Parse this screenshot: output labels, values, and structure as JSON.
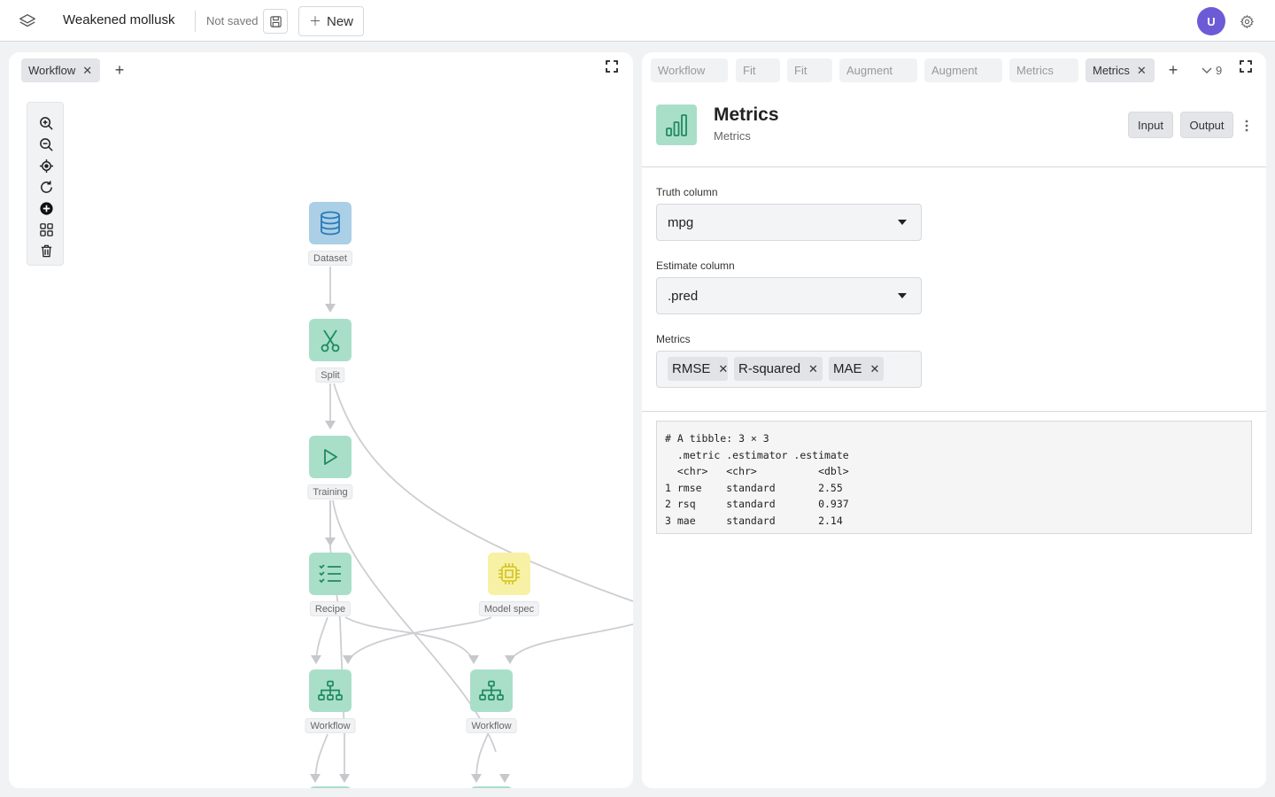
{
  "app": {
    "project_title": "Weakened mollusk",
    "save_status": "Not saved",
    "new_label": "New",
    "user_initial": "U"
  },
  "left_panel": {
    "tabs": [
      {
        "label": "Workflow",
        "active": true
      }
    ]
  },
  "canvas": {
    "tools": [
      "zoom-in",
      "zoom-out",
      "center",
      "reset",
      "add-node",
      "arrange",
      "delete"
    ],
    "nodes": [
      {
        "id": "dataset",
        "label": "Dataset",
        "icon": "database-icon",
        "color": "blue"
      },
      {
        "id": "split",
        "label": "Split",
        "icon": "scissors-icon",
        "color": "green"
      },
      {
        "id": "training",
        "label": "Training",
        "icon": "play-icon",
        "color": "green"
      },
      {
        "id": "recipe",
        "label": "Recipe",
        "icon": "checklist-icon",
        "color": "green"
      },
      {
        "id": "model_spec",
        "label": "Model spec",
        "icon": "chip-icon",
        "color": "yellow"
      },
      {
        "id": "workflow1",
        "label": "Workflow",
        "icon": "hierarchy-icon",
        "color": "green"
      },
      {
        "id": "workflow2",
        "label": "Workflow",
        "icon": "hierarchy-icon",
        "color": "green"
      }
    ]
  },
  "right_panel": {
    "tabs": [
      {
        "label": "Workflow",
        "active": false
      },
      {
        "label": "Fit",
        "active": false
      },
      {
        "label": "Fit",
        "active": false
      },
      {
        "label": "Augment",
        "active": false
      },
      {
        "label": "Augment",
        "active": false
      },
      {
        "label": "Metrics",
        "active": false
      },
      {
        "label": "Metrics",
        "active": true
      }
    ],
    "overflow_count": "9",
    "node_title": "Metrics",
    "node_subtitle": "Metrics",
    "input_label": "Input",
    "output_label": "Output",
    "truth_column": {
      "label": "Truth column",
      "value": "mpg"
    },
    "estimate_column": {
      "label": "Estimate column",
      "value": ".pred"
    },
    "metrics": {
      "label": "Metrics",
      "selected": [
        "RMSE",
        "R-squared",
        "MAE"
      ]
    },
    "output_text": "# A tibble: 3 × 3\n  .metric .estimator .estimate\n  <chr>   <chr>          <dbl>\n1 rmse    standard       2.55 \n2 rsq     standard       0.937\n3 mae     standard       2.14 "
  },
  "colors": {
    "node_green": "#a9dfc9",
    "node_blue": "#aacfe6",
    "node_yellow": "#f7f1a5",
    "icon_green": "#1f8a5f",
    "avatar": "#6b5bd6"
  }
}
